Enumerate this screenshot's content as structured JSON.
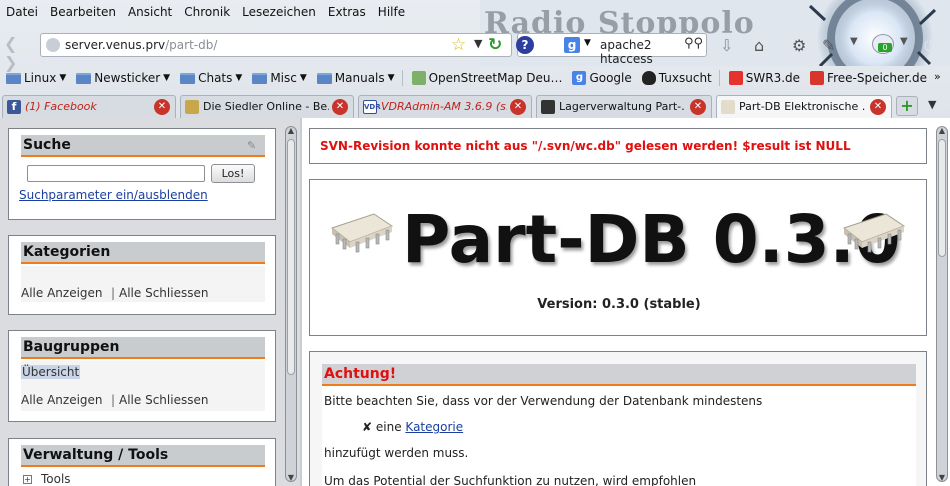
{
  "menubar": [
    "Datei",
    "Bearbeiten",
    "Ansicht",
    "Chronik",
    "Lesezeichen",
    "Extras",
    "Hilfe"
  ],
  "theme": {
    "banner_text": "Radio Stoppolo",
    "badge_count": "0"
  },
  "navbar": {
    "url_host": "server.venus.prv",
    "url_path": "/part-db/",
    "search_value": "apache2 htaccess"
  },
  "bookmarks": [
    {
      "label": "Linux",
      "type": "folder"
    },
    {
      "label": "Newsticker",
      "type": "folder"
    },
    {
      "label": "Chats",
      "type": "folder"
    },
    {
      "label": "Misc",
      "type": "folder"
    },
    {
      "label": "Manuals",
      "type": "folder"
    },
    {
      "label": "OpenStreetMap Deu…",
      "type": "link"
    },
    {
      "label": "Google",
      "type": "link"
    },
    {
      "label": "Tuxsucht",
      "type": "link"
    },
    {
      "label": "SWR3.de",
      "type": "link"
    },
    {
      "label": "Free-Speicher.de",
      "type": "link"
    }
  ],
  "tabs": [
    {
      "label": "(1) Facebook",
      "highlight": true
    },
    {
      "label": "Die Siedler Online - Be…",
      "highlight": false
    },
    {
      "label": "VDRAdmin-AM 3.6.9 (s…",
      "highlight": true
    },
    {
      "label": "Lagerverwaltung Part-…",
      "highlight": false
    },
    {
      "label": "Part-DB Elektronische …",
      "highlight": false
    }
  ],
  "left": {
    "search": {
      "title": "Suche",
      "input_value": "",
      "button": "Los!",
      "toggle_link": "Suchparameter ein/ausblenden"
    },
    "categories": {
      "title": "Kategorien",
      "show_all": "Alle Anzeigen",
      "separator": "|",
      "close_all": "Alle Schliessen"
    },
    "groups": {
      "title": "Baugruppen",
      "overview": "Übersicht",
      "show_all": "Alle Anzeigen",
      "separator": "|",
      "close_all": "Alle Schliessen"
    },
    "tools": {
      "title": "Verwaltung / Tools",
      "tree_item": "Tools"
    }
  },
  "main": {
    "svn_message": "SVN-Revision konnte nicht aus \"/.svn/wc.db\" gelesen werden! $result ist NULL",
    "title": "Part-DB 0.3.0",
    "version": "Version: 0.3.0 (stable)",
    "warning": {
      "title": "Achtung!",
      "line1": "Bitte beachten Sie, dass vor der Verwendung der Datenbank mindestens",
      "bullet_prefix": "✘ eine",
      "bullet_link": "Kategorie",
      "line2": "hinzufügt werden muss.",
      "line3": "Um das Potential der Suchfunktion zu nutzen, wird empfohlen"
    }
  },
  "colors": {
    "accent": "#f07b1a",
    "error": "#e0100e",
    "link": "#1a3fa0"
  }
}
